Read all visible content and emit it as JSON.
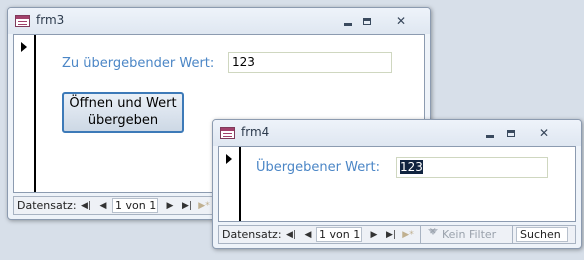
{
  "windows": [
    {
      "title": "frm3",
      "field_label": "Zu übergebender Wert:",
      "field_value": "123",
      "button_label_line1": "Öffnen und Wert",
      "button_label_line2": "übergeben",
      "navigation": {
        "label": "Datensatz:",
        "first": "◀|",
        "prev": "◀",
        "record": "1 von 1",
        "next": "▶",
        "last": "▶|",
        "new": "▶*"
      }
    },
    {
      "title": "frm4",
      "field_label": "Übergebener Wert:",
      "field_value": "123",
      "navigation": {
        "label": "Datensatz:",
        "first": "◀|",
        "prev": "◀",
        "record": "1 von 1",
        "next": "▶",
        "last": "▶|",
        "new": "▶*",
        "filter_label": "Kein Filter",
        "search_label": "Suchen"
      }
    }
  ],
  "icons": {
    "minimize": "minimize-icon",
    "maximize": "maximize-icon",
    "close": "close-icon",
    "app": "access-form-icon",
    "record_selector": "record-pointer-icon"
  },
  "controls": {
    "close_glyph": "✕"
  },
  "colors": {
    "label": "#4b86c6",
    "button_border": "#3d7ab8",
    "selection": "#10233f",
    "desktop": "#d7dfe9"
  }
}
